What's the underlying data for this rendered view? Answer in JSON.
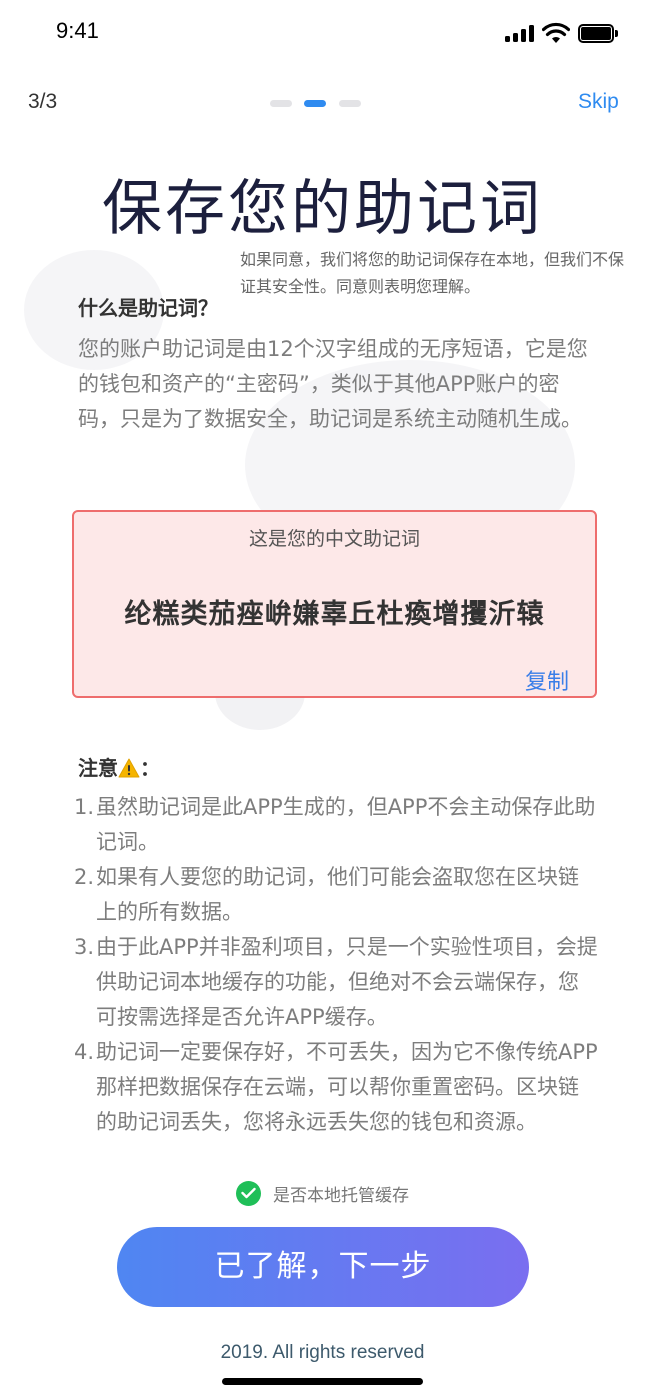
{
  "status_bar": {
    "time": "9:41"
  },
  "header": {
    "step": "3/3",
    "total_steps": 3,
    "current_step": 2,
    "skip_label": "Skip"
  },
  "title": "保存您的助记词",
  "subtitle": "如果同意，我们将您的助记词保存在本地，但我们不保证其安全性。同意则表明您理解。",
  "what_section": {
    "heading": "什么是助记词？",
    "body": "您的账户助记词是由12个汉字组成的无序短语，它是您的钱包和资产的“主密码”，类似于其他APP账户的密码，只是为了数据安全，助记词是系统主动随机生成。"
  },
  "mnemonic": {
    "caption": "这是您的中文助记词",
    "words": "纶糕类茄痤峅嫌辜丘杜瘓增攫沂辕",
    "copy_label": "复制"
  },
  "notice": {
    "heading": "注意",
    "colon": "：",
    "items": [
      {
        "num": "1.",
        "text": "虽然助记词是此APP生成的，但APP不会主动保存此助记词。"
      },
      {
        "num": "2.",
        "text": "如果有人要您的助记词，他们可能会盗取您在区块链上的所有数据。"
      },
      {
        "num": "3.",
        "text": "由于此APP并非盈利项目，只是一个实验性项目，会提供助记词本地缓存的功能，但绝对不会云端保存，您可按需选择是否允许APP缓存。"
      },
      {
        "num": "4.",
        "text": "助记词一定要保存好，不可丢失，因为它不像传统APP那样把数据保存在云端，可以帮你重置密码。区块链的助记词丢失，您将永远丢失您的钱包和资源。"
      }
    ]
  },
  "cache_option": {
    "label": "是否本地托管缓存",
    "checked": true
  },
  "next_button": {
    "label": "已了解，下一步"
  },
  "footer": "2019. All rights reserved",
  "colors": {
    "accent": "#2f8bf0",
    "danger_border": "#ee6d6d",
    "danger_bg": "#fde8e8",
    "success": "#1fbf58",
    "button_start": "#4f86f2",
    "button_end": "#7a6ef0"
  }
}
